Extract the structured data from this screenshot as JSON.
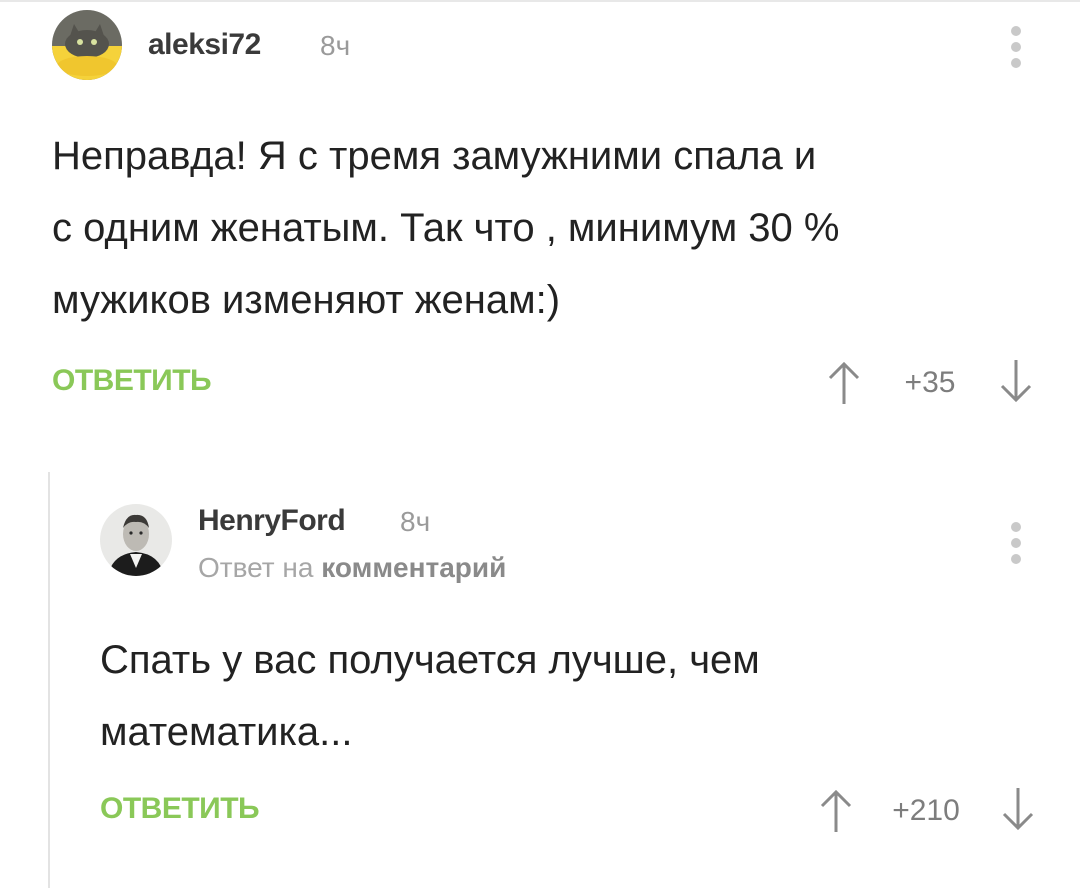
{
  "comments": [
    {
      "username": "aleksi72",
      "time": "8ч",
      "text_lines": [
        "Неправда! Я с тремя замужними спала и",
        "с одним женатым. Так что , минимум 30 %",
        "мужиков изменяют женам:)"
      ],
      "reply_label": "ОТВЕТИТЬ",
      "score": "+35"
    },
    {
      "username": "HenryFord",
      "time": "8ч",
      "reply_prefix": "Ответ на",
      "reply_target": "комментарий",
      "text_lines": [
        "Спать у вас получается лучше, чем",
        "математика..."
      ],
      "reply_label": "ОТВЕТИТЬ",
      "score": "+210"
    }
  ],
  "colors": {
    "accent": "#8ac858",
    "muted": "#9a9a9a",
    "text": "#222222"
  },
  "icons": {
    "vote_up": "arrow-up-icon",
    "vote_down": "arrow-down-icon",
    "menu": "kebab-menu-icon"
  }
}
